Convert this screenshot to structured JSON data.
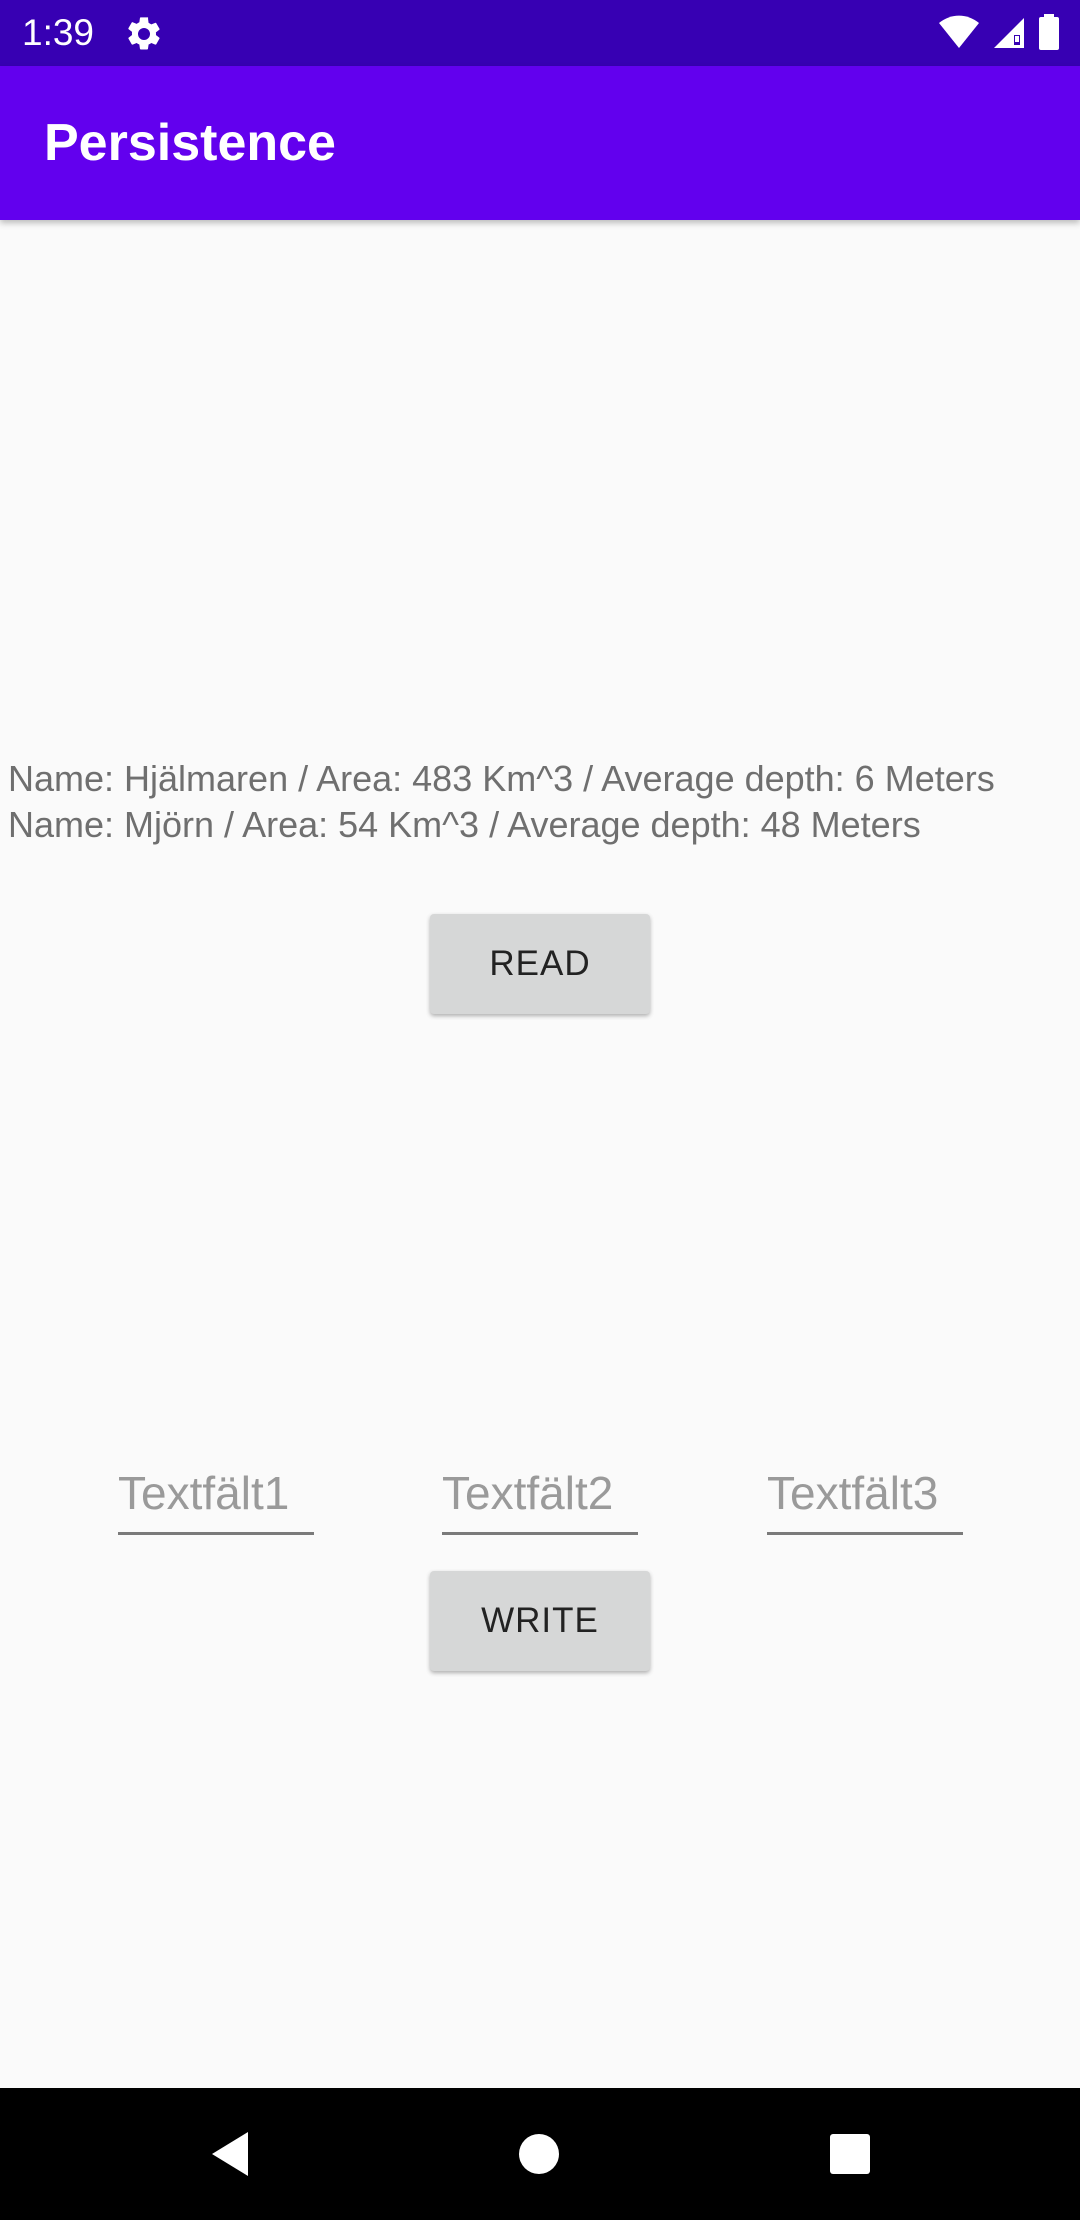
{
  "status_bar": {
    "time": "1:39",
    "icons": [
      "settings-gear-icon",
      "wifi-icon",
      "cell-signal-icon",
      "battery-icon"
    ]
  },
  "app_bar": {
    "title": "Persistence"
  },
  "lakes": [
    "Name: Hjälmaren / Area: 483 Km^3 / Average depth: 6 Meters",
    "Name: Mjörn / Area: 54 Km^3 / Average depth: 48 Meters"
  ],
  "buttons": {
    "read": "READ",
    "write": "WRITE"
  },
  "fields": [
    {
      "placeholder": "Textfält1",
      "value": ""
    },
    {
      "placeholder": "Textfält2",
      "value": ""
    },
    {
      "placeholder": "Textfält3",
      "value": ""
    }
  ],
  "nav_bar": {
    "icons": [
      "back-icon",
      "home-icon",
      "recents-icon"
    ]
  },
  "colors": {
    "status_bar": "#3700b3",
    "app_bar": "#6200ee",
    "background": "#fafafa",
    "button": "#d6d7d7",
    "nav_bar": "#000000"
  }
}
